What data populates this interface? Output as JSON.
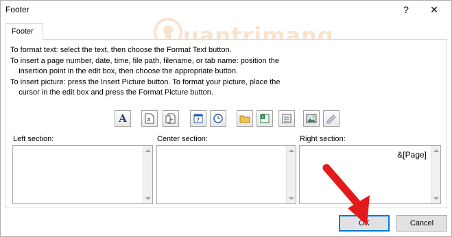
{
  "window": {
    "title": "Footer",
    "help_label": "?",
    "close_label": "✕"
  },
  "watermark": {
    "text": "uantrimang"
  },
  "tab": {
    "label": "Footer"
  },
  "instructions": [
    "To format text:  select the text, then choose the Format Text button.",
    "To insert a page number, date, time, file path, filename, or tab name:  position the",
    "    insertion point in the edit box, then choose the appropriate button.",
    "To insert picture: press the Insert Picture button.  To format your picture, place the",
    "    cursor in the edit box and press the Format Picture button."
  ],
  "toolbar": {
    "format_text_glyph": "A",
    "buttons": [
      "format-text-icon",
      "page-number-icon",
      "number-of-pages-icon",
      "date-icon",
      "time-icon",
      "file-path-icon",
      "filename-icon",
      "sheet-name-icon",
      "insert-picture-icon",
      "format-picture-icon"
    ]
  },
  "sections": {
    "left": {
      "label": "Left section:",
      "value": ""
    },
    "center": {
      "label": "Center section:",
      "value": ""
    },
    "right": {
      "label": "Right section:",
      "value": "&[Page]"
    }
  },
  "buttons": {
    "ok": "OK",
    "cancel": "Cancel"
  },
  "colors": {
    "accent": "#0078d7",
    "arrow": "#e41a1a",
    "watermark": "#f4c99a"
  }
}
